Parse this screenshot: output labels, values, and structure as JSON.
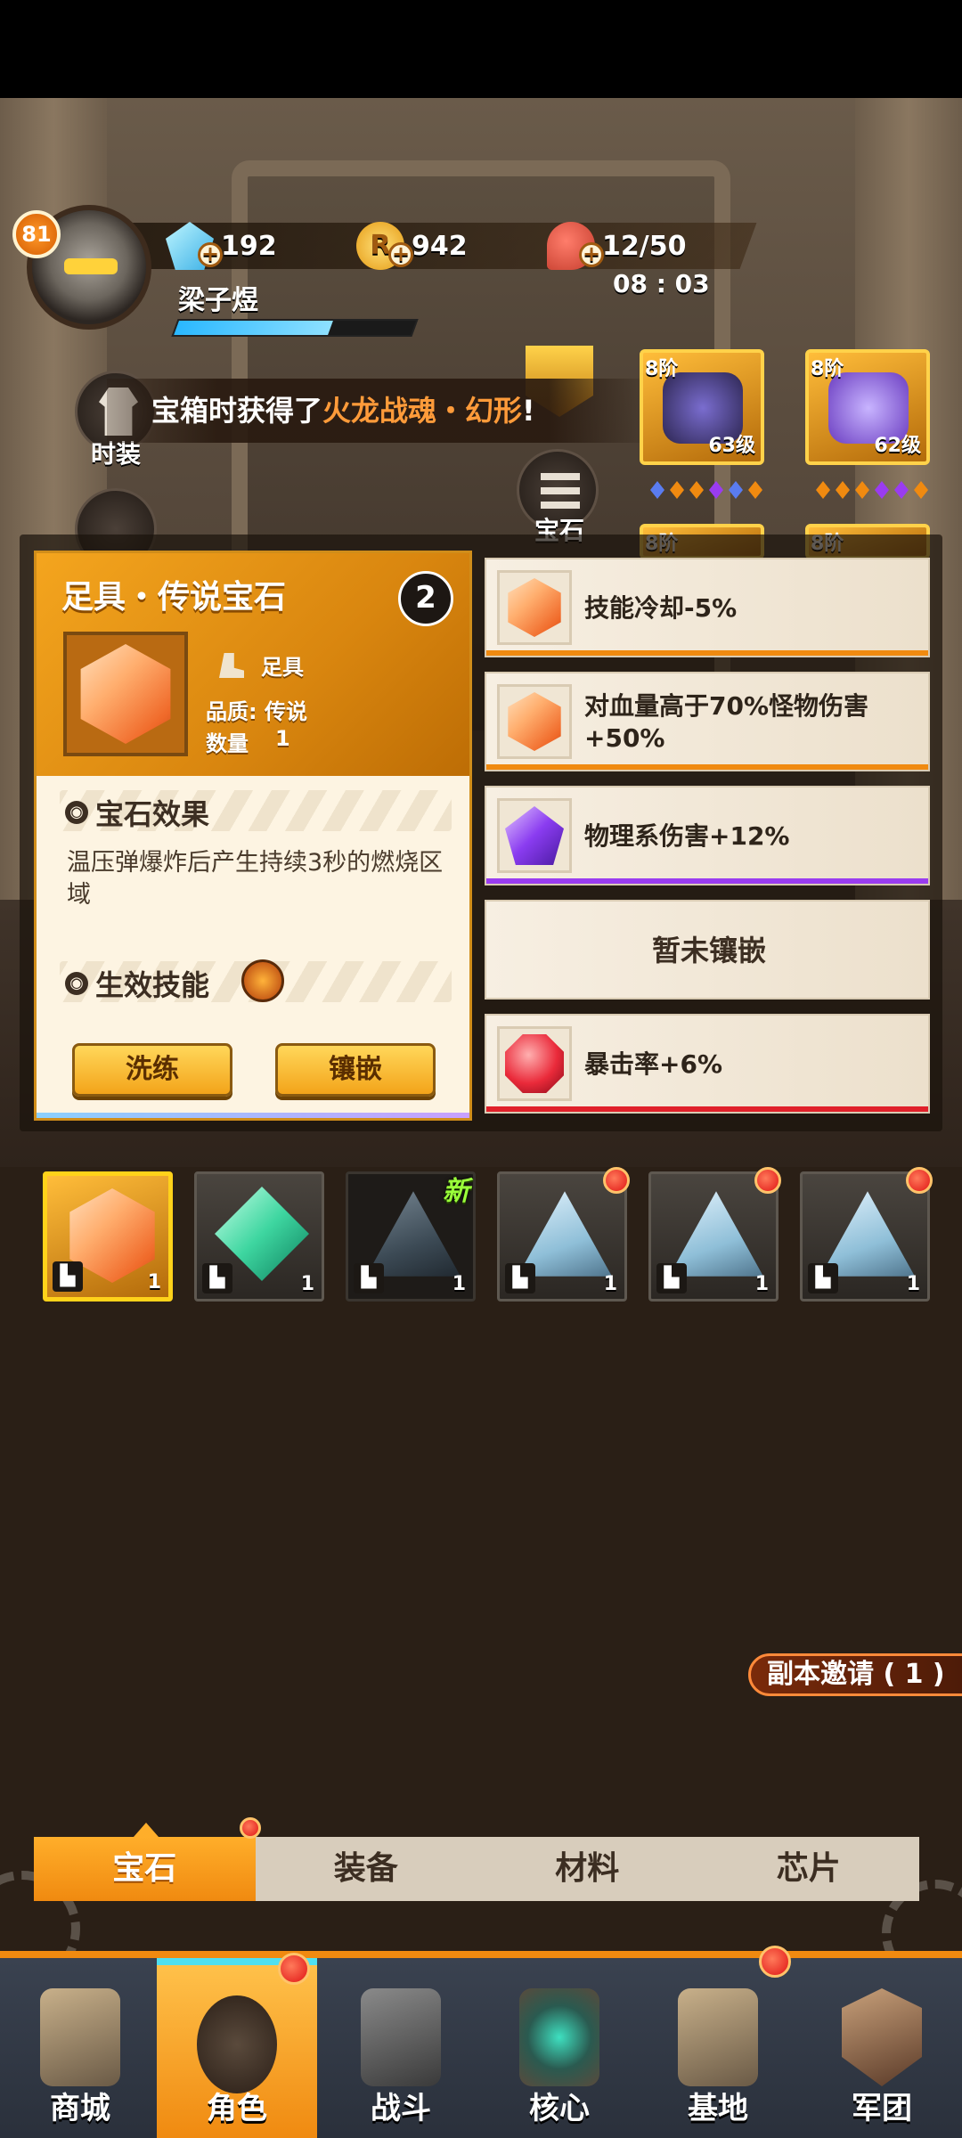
{
  "player": {
    "level": "81",
    "name": "梁子煜",
    "xp_fraction": 0.65
  },
  "resources": {
    "gems": "192",
    "coins": "942",
    "coin_symbol": "R",
    "stamina": "12/50",
    "timer": "08 : 03"
  },
  "notice": {
    "prefix": "宝箱时获得了",
    "highlight": "火龙战魂・幻形",
    "suffix": "!"
  },
  "side_buttons": {
    "fashion": "时装",
    "gem": "宝石"
  },
  "equipment": [
    {
      "tier": "8阶",
      "level": "63级"
    },
    {
      "tier": "8阶",
      "level": "62级"
    },
    {
      "tier": "8阶"
    },
    {
      "tier": "8阶"
    }
  ],
  "detail": {
    "title": "足具・传说宝石",
    "refresh_glyph": "2",
    "slot_type": "足具",
    "quality": "品质: 传说",
    "quantity_label": "数量",
    "quantity": "1",
    "effect_heading": "宝石效果",
    "effect_text": "温压弹爆炸后产生持续3秒的燃烧区域",
    "skill_heading": "生效技能",
    "refine_button": "洗练",
    "inlay_button": "镶嵌"
  },
  "slots": [
    {
      "text": "技能冷却-5%",
      "gem": "orange"
    },
    {
      "text": "对血量高于70%怪物伤害+50%",
      "gem": "orange"
    },
    {
      "text": "物理系伤害+12%",
      "gem": "purple"
    },
    {
      "text": "暂未镶嵌",
      "gem": "none"
    },
    {
      "text": "暴击率+6%",
      "gem": "red"
    }
  ],
  "inventory": [
    {
      "gem": "orange",
      "count": "1",
      "selected": true
    },
    {
      "gem": "green",
      "count": "1"
    },
    {
      "gem": "dark",
      "count": "1",
      "new_tag": "新"
    },
    {
      "gem": "white",
      "count": "1",
      "alert": true
    },
    {
      "gem": "white",
      "count": "1",
      "alert": true
    },
    {
      "gem": "white",
      "count": "1",
      "alert": true
    }
  ],
  "invite": "副本邀请 ( 1 )",
  "tabs": [
    "宝石",
    "装备",
    "材料",
    "芯片"
  ],
  "nav": [
    "商城",
    "角色",
    "战斗",
    "核心",
    "基地",
    "军团"
  ],
  "colors": {
    "accent": "#f08a10",
    "orange_bar": "#f08a10",
    "purple_bar": "#9a3cf0",
    "red_bar": "#e0202a"
  }
}
